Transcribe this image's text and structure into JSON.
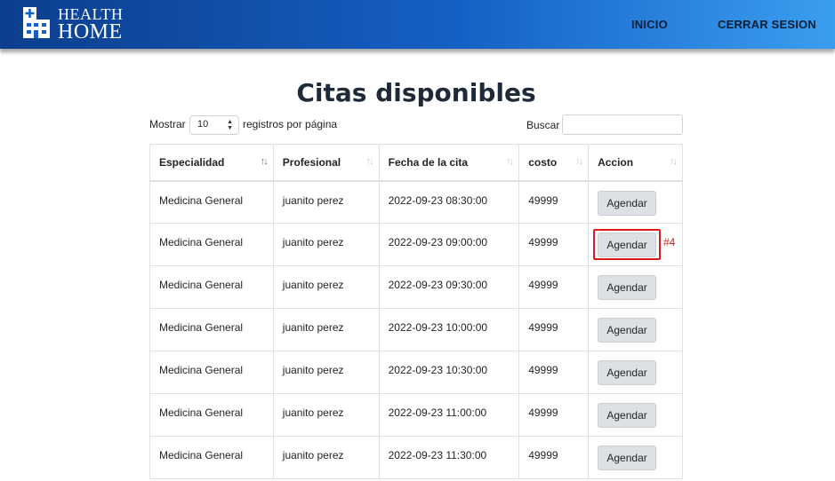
{
  "header": {
    "logo_line1": "HEALTH",
    "logo_line2": "HOME",
    "nav": [
      "INICIO",
      "CERRAR SESION"
    ]
  },
  "page": {
    "title": "Citas disponibles"
  },
  "controls": {
    "length_prefix": "Mostrar",
    "length_value": "10",
    "length_suffix": "registros por página",
    "search_label": "Buscar",
    "search_value": ""
  },
  "table": {
    "columns": [
      "Especialidad",
      "Profesional",
      "Fecha de la cita",
      "costo",
      "Accion"
    ],
    "rows": [
      [
        "Medicina General",
        "juanito perez",
        "2022-09-23 08:30:00",
        "49999",
        "Agendar"
      ],
      [
        "Medicina General",
        "juanito perez",
        "2022-09-23 09:00:00",
        "49999",
        "Agendar"
      ],
      [
        "Medicina General",
        "juanito perez",
        "2022-09-23 09:30:00",
        "49999",
        "Agendar"
      ],
      [
        "Medicina General",
        "juanito perez",
        "2022-09-23 10:00:00",
        "49999",
        "Agendar"
      ],
      [
        "Medicina General",
        "juanito perez",
        "2022-09-23 10:30:00",
        "49999",
        "Agendar"
      ],
      [
        "Medicina General",
        "juanito perez",
        "2022-09-23 11:00:00",
        "49999",
        "Agendar"
      ],
      [
        "Medicina General",
        "juanito perez",
        "2022-09-23 11:30:00",
        "49999",
        "Agendar"
      ]
    ]
  },
  "annotation": {
    "label": "#4",
    "row_index": 1,
    "color": "#e01b1b"
  },
  "colors": {
    "nav_dark": "#0c3e8d",
    "nav_light": "#3a9ef0",
    "button_bg": "#dde1e6"
  },
  "icons": {
    "logo": "hospital-building-icon",
    "sort": "sort-arrows-icon"
  }
}
